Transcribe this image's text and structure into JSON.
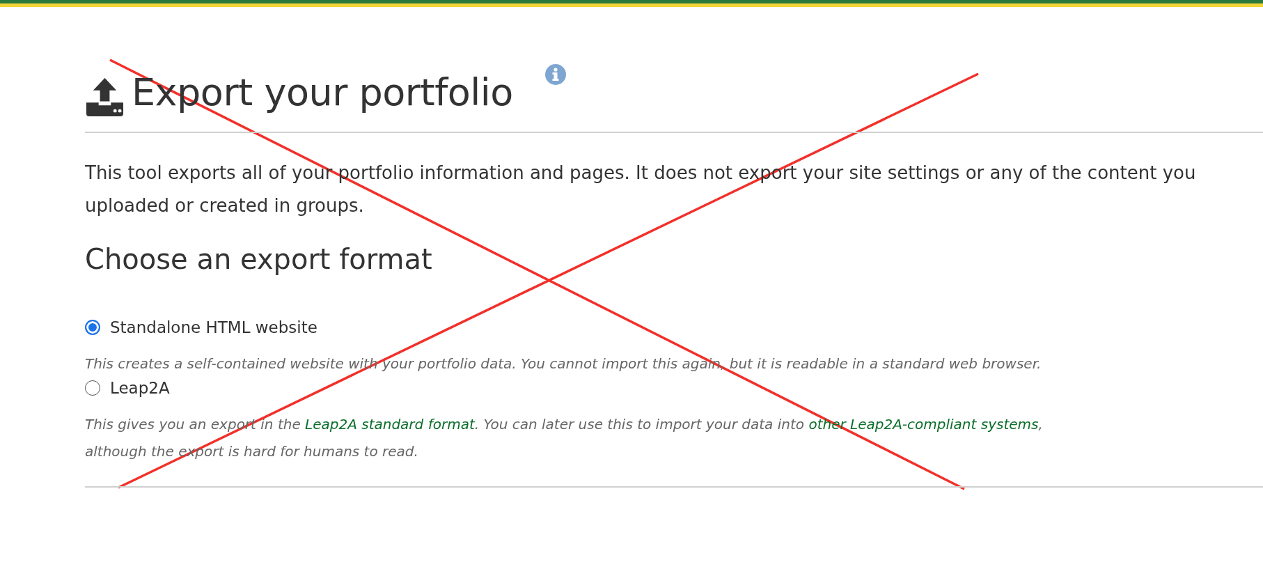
{
  "page": {
    "title": "Export your portfolio",
    "intro": "This tool exports all of your portfolio information and pages. It does not export your site settings or any of the content you uploaded or created in groups."
  },
  "section": {
    "title": "Choose an export format"
  },
  "options": [
    {
      "label": "Standalone HTML website",
      "selected": true,
      "description": [
        {
          "kind": "text",
          "text": "This creates a self-contained website with your portfolio data. You cannot import this again, but it is readable in a standard web browser."
        }
      ]
    },
    {
      "label": "Leap2A",
      "selected": false,
      "description": [
        {
          "kind": "text",
          "text": "This gives you an export in the "
        },
        {
          "kind": "link",
          "text": "Leap2A standard format"
        },
        {
          "kind": "text",
          "text": ". You can later use this to import your data into "
        },
        {
          "kind": "link",
          "text": "other Leap2A-compliant systems"
        },
        {
          "kind": "text",
          "text": ", although the export is hard for humans to read."
        }
      ]
    }
  ]
}
